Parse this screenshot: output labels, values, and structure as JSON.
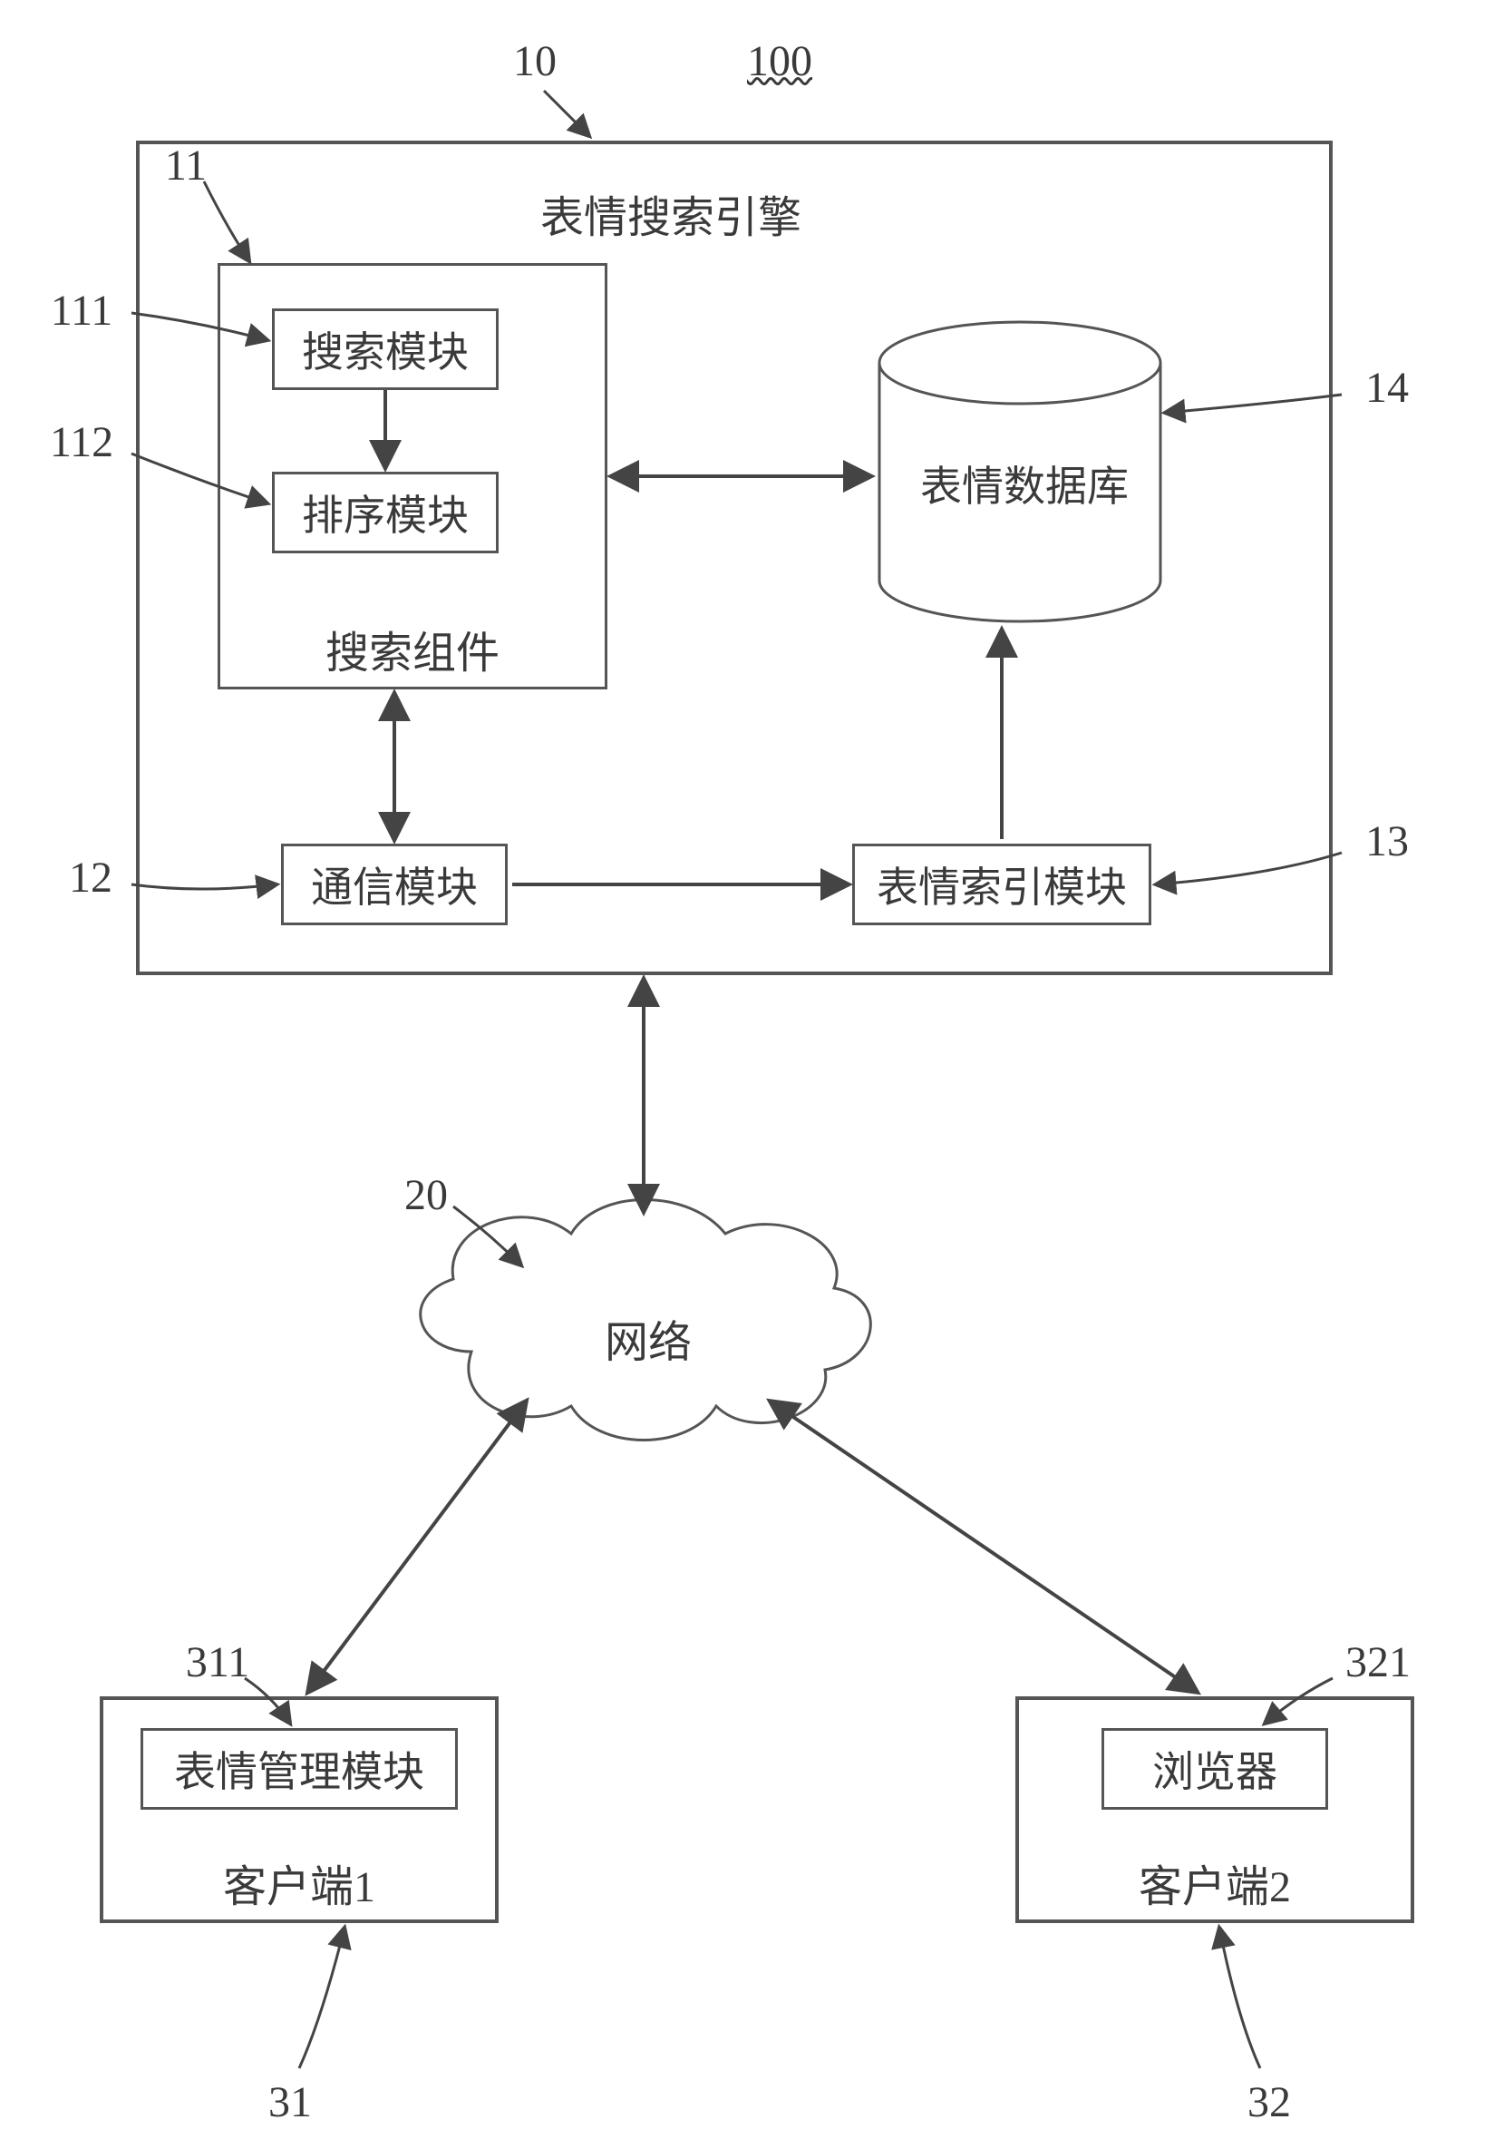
{
  "refs": {
    "system": "100",
    "engine": "10",
    "search_component": "11",
    "search_module": "111",
    "sort_module": "112",
    "comm_module": "12",
    "index_module": "13",
    "database": "14",
    "network": "20",
    "client1": "31",
    "client1_module": "311",
    "client2": "32",
    "client2_module": "321"
  },
  "labels": {
    "engine_title": "表情搜索引擎",
    "search_module": "搜索模块",
    "sort_module": "排序模块",
    "search_component": "搜索组件",
    "database": "表情数据库",
    "comm_module": "通信模块",
    "index_module": "表情索引模块",
    "network": "网络",
    "client1_module": "表情管理模块",
    "client1": "客户端1",
    "client2_module": "浏览器",
    "client2": "客户端2"
  }
}
